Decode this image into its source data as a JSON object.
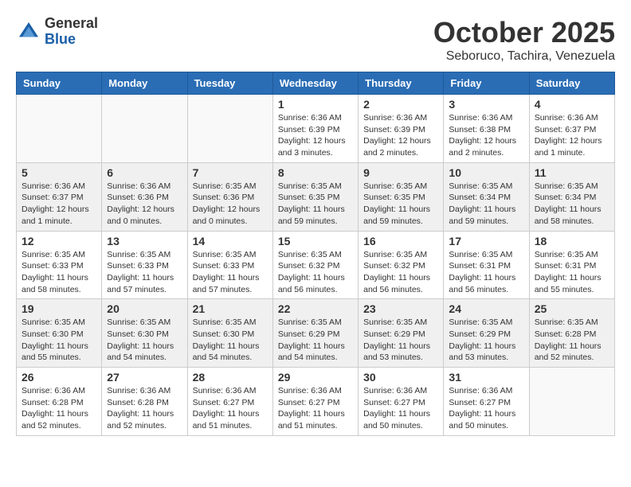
{
  "header": {
    "logo_general": "General",
    "logo_blue": "Blue",
    "month": "October 2025",
    "location": "Seboruco, Tachira, Venezuela"
  },
  "weekdays": [
    "Sunday",
    "Monday",
    "Tuesday",
    "Wednesday",
    "Thursday",
    "Friday",
    "Saturday"
  ],
  "weeks": [
    [
      {
        "day": "",
        "info": ""
      },
      {
        "day": "",
        "info": ""
      },
      {
        "day": "",
        "info": ""
      },
      {
        "day": "1",
        "info": "Sunrise: 6:36 AM\nSunset: 6:39 PM\nDaylight: 12 hours\nand 3 minutes."
      },
      {
        "day": "2",
        "info": "Sunrise: 6:36 AM\nSunset: 6:39 PM\nDaylight: 12 hours\nand 2 minutes."
      },
      {
        "day": "3",
        "info": "Sunrise: 6:36 AM\nSunset: 6:38 PM\nDaylight: 12 hours\nand 2 minutes."
      },
      {
        "day": "4",
        "info": "Sunrise: 6:36 AM\nSunset: 6:37 PM\nDaylight: 12 hours\nand 1 minute."
      }
    ],
    [
      {
        "day": "5",
        "info": "Sunrise: 6:36 AM\nSunset: 6:37 PM\nDaylight: 12 hours\nand 1 minute."
      },
      {
        "day": "6",
        "info": "Sunrise: 6:36 AM\nSunset: 6:36 PM\nDaylight: 12 hours\nand 0 minutes."
      },
      {
        "day": "7",
        "info": "Sunrise: 6:35 AM\nSunset: 6:36 PM\nDaylight: 12 hours\nand 0 minutes."
      },
      {
        "day": "8",
        "info": "Sunrise: 6:35 AM\nSunset: 6:35 PM\nDaylight: 11 hours\nand 59 minutes."
      },
      {
        "day": "9",
        "info": "Sunrise: 6:35 AM\nSunset: 6:35 PM\nDaylight: 11 hours\nand 59 minutes."
      },
      {
        "day": "10",
        "info": "Sunrise: 6:35 AM\nSunset: 6:34 PM\nDaylight: 11 hours\nand 59 minutes."
      },
      {
        "day": "11",
        "info": "Sunrise: 6:35 AM\nSunset: 6:34 PM\nDaylight: 11 hours\nand 58 minutes."
      }
    ],
    [
      {
        "day": "12",
        "info": "Sunrise: 6:35 AM\nSunset: 6:33 PM\nDaylight: 11 hours\nand 58 minutes."
      },
      {
        "day": "13",
        "info": "Sunrise: 6:35 AM\nSunset: 6:33 PM\nDaylight: 11 hours\nand 57 minutes."
      },
      {
        "day": "14",
        "info": "Sunrise: 6:35 AM\nSunset: 6:33 PM\nDaylight: 11 hours\nand 57 minutes."
      },
      {
        "day": "15",
        "info": "Sunrise: 6:35 AM\nSunset: 6:32 PM\nDaylight: 11 hours\nand 56 minutes."
      },
      {
        "day": "16",
        "info": "Sunrise: 6:35 AM\nSunset: 6:32 PM\nDaylight: 11 hours\nand 56 minutes."
      },
      {
        "day": "17",
        "info": "Sunrise: 6:35 AM\nSunset: 6:31 PM\nDaylight: 11 hours\nand 56 minutes."
      },
      {
        "day": "18",
        "info": "Sunrise: 6:35 AM\nSunset: 6:31 PM\nDaylight: 11 hours\nand 55 minutes."
      }
    ],
    [
      {
        "day": "19",
        "info": "Sunrise: 6:35 AM\nSunset: 6:30 PM\nDaylight: 11 hours\nand 55 minutes."
      },
      {
        "day": "20",
        "info": "Sunrise: 6:35 AM\nSunset: 6:30 PM\nDaylight: 11 hours\nand 54 minutes."
      },
      {
        "day": "21",
        "info": "Sunrise: 6:35 AM\nSunset: 6:30 PM\nDaylight: 11 hours\nand 54 minutes."
      },
      {
        "day": "22",
        "info": "Sunrise: 6:35 AM\nSunset: 6:29 PM\nDaylight: 11 hours\nand 54 minutes."
      },
      {
        "day": "23",
        "info": "Sunrise: 6:35 AM\nSunset: 6:29 PM\nDaylight: 11 hours\nand 53 minutes."
      },
      {
        "day": "24",
        "info": "Sunrise: 6:35 AM\nSunset: 6:29 PM\nDaylight: 11 hours\nand 53 minutes."
      },
      {
        "day": "25",
        "info": "Sunrise: 6:35 AM\nSunset: 6:28 PM\nDaylight: 11 hours\nand 52 minutes."
      }
    ],
    [
      {
        "day": "26",
        "info": "Sunrise: 6:36 AM\nSunset: 6:28 PM\nDaylight: 11 hours\nand 52 minutes."
      },
      {
        "day": "27",
        "info": "Sunrise: 6:36 AM\nSunset: 6:28 PM\nDaylight: 11 hours\nand 52 minutes."
      },
      {
        "day": "28",
        "info": "Sunrise: 6:36 AM\nSunset: 6:27 PM\nDaylight: 11 hours\nand 51 minutes."
      },
      {
        "day": "29",
        "info": "Sunrise: 6:36 AM\nSunset: 6:27 PM\nDaylight: 11 hours\nand 51 minutes."
      },
      {
        "day": "30",
        "info": "Sunrise: 6:36 AM\nSunset: 6:27 PM\nDaylight: 11 hours\nand 50 minutes."
      },
      {
        "day": "31",
        "info": "Sunrise: 6:36 AM\nSunset: 6:27 PM\nDaylight: 11 hours\nand 50 minutes."
      },
      {
        "day": "",
        "info": ""
      }
    ]
  ]
}
